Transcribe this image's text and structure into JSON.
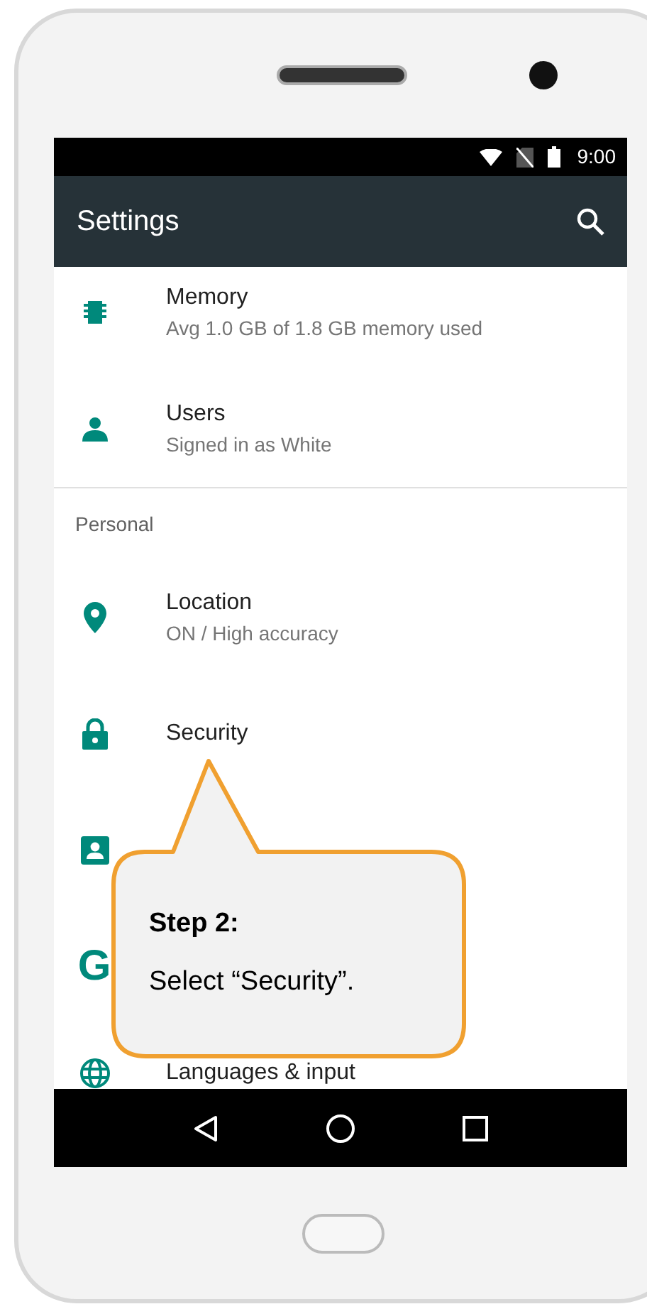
{
  "status_bar": {
    "time": "9:00"
  },
  "toolbar": {
    "title": "Settings"
  },
  "items": [
    {
      "kind": "setting",
      "title": "Memory",
      "subtitle": "Avg 1.0 GB of 1.8 GB memory used"
    },
    {
      "kind": "setting",
      "title": "Users",
      "subtitle": "Signed in as White"
    },
    {
      "kind": "header",
      "title": "Personal"
    },
    {
      "kind": "setting",
      "title": "Location",
      "subtitle": "ON / High accuracy"
    },
    {
      "kind": "setting",
      "title": "Security"
    },
    {
      "kind": "setting"
    },
    {
      "kind": "setting",
      "icon_text": "G"
    },
    {
      "kind": "setting",
      "title": "Languages & input"
    }
  ],
  "callout": {
    "heading": "Step 2:",
    "text": "Select “Security”."
  }
}
